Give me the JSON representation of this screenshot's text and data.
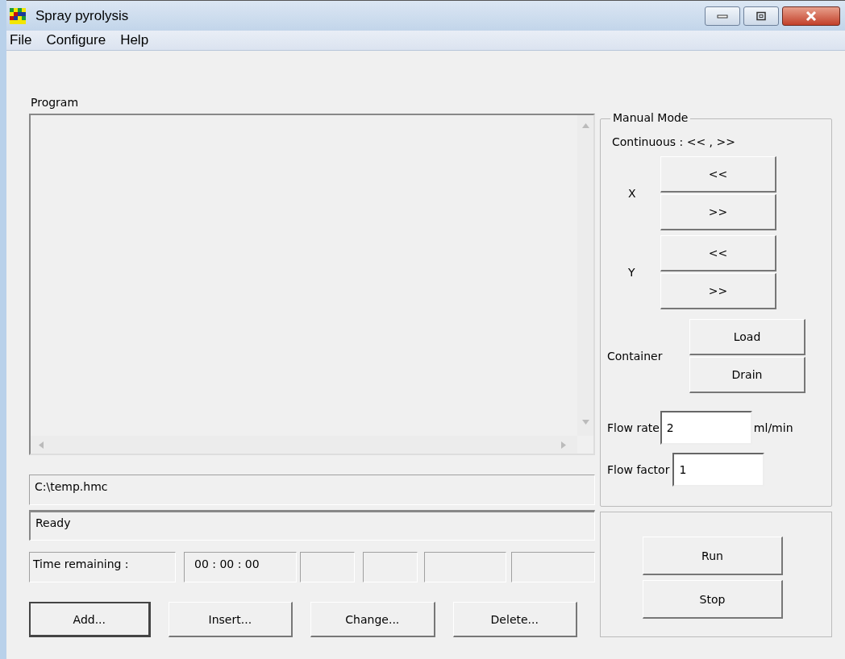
{
  "window": {
    "title": "Spray pyrolysis"
  },
  "menu": [
    "File",
    "Configure",
    "Help"
  ],
  "program": {
    "label": "Program"
  },
  "file_path": "C:\\temp.hmc",
  "status": "Ready",
  "time": {
    "label": "Time remaining :",
    "value": "00 : 00 : 00"
  },
  "program_buttons": [
    {
      "label": "Add...",
      "default": true
    },
    {
      "label": "Insert...",
      "default": false
    },
    {
      "label": "Change...",
      "default": false
    },
    {
      "label": "Delete...",
      "default": false
    }
  ],
  "manual_mode": {
    "title": "Manual Mode",
    "hint": "Continuous : << , >>",
    "axes": [
      {
        "label": "X",
        "buttons": [
          "<<",
          ">>"
        ]
      },
      {
        "label": "Y",
        "buttons": [
          "<<",
          ">>"
        ]
      }
    ],
    "container": {
      "label": "Container",
      "buttons": [
        "Load",
        "Drain"
      ]
    },
    "flow_rate": {
      "label": "Flow rate",
      "value": "2",
      "unit": "ml/min"
    },
    "flow_factor": {
      "label": "Flow factor",
      "value": "1"
    }
  },
  "run_buttons": [
    "Run",
    "Stop"
  ]
}
